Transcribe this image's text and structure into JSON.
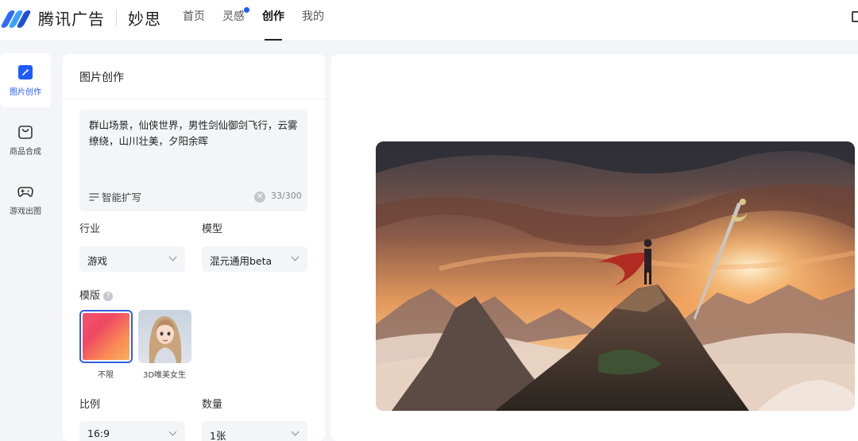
{
  "brand": {
    "name": "腾讯广告",
    "product": "妙思"
  },
  "topnav": [
    {
      "label": "首页",
      "active": false,
      "dot": false
    },
    {
      "label": "灵感",
      "active": false,
      "dot": true
    },
    {
      "label": "创作",
      "active": true,
      "dot": false
    },
    {
      "label": "我的",
      "active": false,
      "dot": false
    }
  ],
  "rail": [
    {
      "label": "图片创作",
      "icon": "image-create-icon",
      "active": true
    },
    {
      "label": "商品合成",
      "icon": "shopping-bag-icon",
      "active": false
    },
    {
      "label": "游戏出图",
      "icon": "gamepad-icon",
      "active": false
    }
  ],
  "panel": {
    "title": "图片创作",
    "prompt": "群山场景，仙侠世界，男性剑仙御剑飞行，云雾缭绕，山川壮美，夕阳余晖",
    "expand_label": "智能扩写",
    "counter": "33/300",
    "industry": {
      "label": "行业",
      "value": "游戏"
    },
    "model": {
      "label": "模型",
      "value": "混元通用beta"
    },
    "template": {
      "label": "模版",
      "items": [
        {
          "caption": "不限",
          "selected": true
        },
        {
          "caption": "3D唯美女生",
          "selected": false
        }
      ]
    },
    "ratio": {
      "label": "比例",
      "value": "16:9"
    },
    "quantity": {
      "label": "数量",
      "value": "1张"
    }
  },
  "colors": {
    "accent": "#1e5bff",
    "selected_border": "#2f5fe0"
  }
}
